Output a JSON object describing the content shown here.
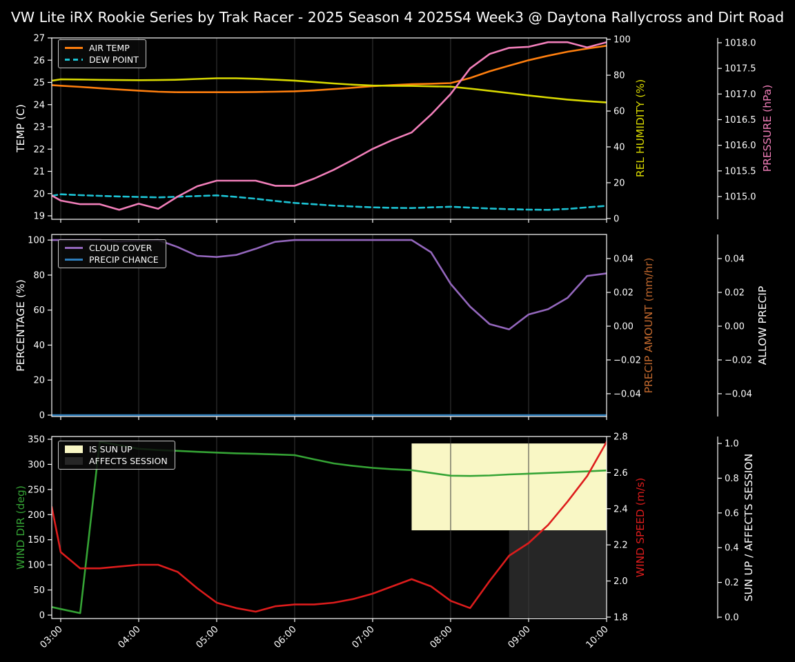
{
  "title": "VW Lite iRX Rookie Series by Trak Racer - 2025 Season 4 2025S4 Week3 @ Daytona Rallycross and Dirt Road",
  "colors": {
    "background": "#000000",
    "text": "#ffffff",
    "grid": "#3a3a3a",
    "spine": "#ffffff",
    "air_temp": "#ff7f0e",
    "dew_point": "#1cc3d4",
    "rel_humidity": "#d9d900",
    "pressure": "#f27fba",
    "cloud_cover": "#9467bd",
    "precip_chance": "#2e7ebc",
    "precip_amount_label": "#c2692e",
    "wind_dir": "#35a435",
    "wind_speed": "#dd1c1c",
    "sun_band": "#f9f7c5",
    "session_band": "#262626"
  },
  "time": {
    "hours": [
      2.885,
      3,
      3.25,
      3.5,
      3.75,
      4,
      4.25,
      4.5,
      4.75,
      5,
      5.25,
      5.5,
      5.75,
      6,
      6.25,
      6.5,
      6.75,
      7,
      7.25,
      7.5,
      7.75,
      8,
      8.25,
      8.5,
      8.75,
      9,
      9.25,
      9.5,
      9.75,
      10
    ],
    "range": [
      2.885,
      10.0
    ],
    "tick_hours": [
      3,
      4,
      5,
      6,
      7,
      8,
      9,
      10
    ],
    "tick_labels": [
      "03:00",
      "04:00",
      "05:00",
      "06:00",
      "07:00",
      "08:00",
      "09:00",
      "10:00"
    ]
  },
  "chart_data": [
    {
      "type": "line",
      "name": "temperature-humidity-pressure",
      "axes": {
        "left": {
          "label": "TEMP (C)",
          "color": "#ffffff",
          "range": [
            18.845,
            27.0
          ],
          "tick_values": [
            19,
            20,
            21,
            22,
            23,
            24,
            25,
            26,
            27
          ],
          "tick_labels": [
            "19",
            "20",
            "21",
            "22",
            "23",
            "24",
            "25",
            "26",
            "27"
          ]
        },
        "right": {
          "label": "REL HUMIDITY (%)",
          "color": "#d9d900",
          "range": [
            -0.4,
            100.8
          ],
          "tick_values": [
            0,
            20,
            40,
            60,
            80,
            100
          ],
          "tick_labels": [
            "0",
            "20",
            "40",
            "60",
            "80",
            "100"
          ]
        },
        "far_right": {
          "label": "PRESSURE (hPa)",
          "color": "#f27fba",
          "range": [
            1014.556,
            1018.094
          ],
          "tick_values": [
            1015.0,
            1015.5,
            1016.0,
            1016.5,
            1017.0,
            1017.5,
            1018.0
          ],
          "tick_labels": [
            "1015.0",
            "1015.5",
            "1016.0",
            "1016.5",
            "1017.0",
            "1017.5",
            "1018.0"
          ]
        }
      },
      "legend": [
        {
          "label": "AIR TEMP",
          "color": "#ff7f0e",
          "style": "line"
        },
        {
          "label": "DEW POINT",
          "color": "#1cc3d4",
          "style": "dashed-line"
        }
      ],
      "series": [
        {
          "name": "AIR TEMP",
          "axis": "left",
          "color": "#ff7f0e",
          "dash": null,
          "y": [
            24.88,
            24.85,
            24.8,
            24.74,
            24.68,
            24.63,
            24.58,
            24.56,
            24.56,
            24.56,
            24.56,
            24.57,
            24.58,
            24.6,
            24.64,
            24.7,
            24.76,
            24.83,
            24.88,
            24.92,
            24.94,
            24.97,
            25.2,
            25.5,
            25.75,
            26.0,
            26.2,
            26.38,
            26.52,
            26.65
          ]
        },
        {
          "name": "DEW POINT",
          "axis": "left",
          "color": "#1cc3d4",
          "dash": "8,5",
          "y": [
            19.9,
            19.97,
            19.93,
            19.9,
            19.87,
            19.85,
            19.83,
            19.86,
            19.89,
            19.92,
            19.85,
            19.77,
            19.67,
            19.58,
            19.52,
            19.46,
            19.42,
            19.38,
            19.36,
            19.35,
            19.38,
            19.41,
            19.37,
            19.33,
            19.3,
            19.28,
            19.27,
            19.31,
            19.38,
            19.45
          ]
        },
        {
          "name": "REL HUMIDITY",
          "axis": "right",
          "color": "#d9d900",
          "dash": null,
          "y": [
            76.9,
            77.7,
            77.6,
            77.4,
            77.3,
            77.2,
            77.3,
            77.5,
            77.9,
            78.3,
            78.3,
            78.0,
            77.5,
            77.0,
            76.2,
            75.4,
            74.7,
            74.2,
            74.1,
            74.0,
            73.8,
            73.6,
            72.5,
            71.3,
            70.0,
            68.7,
            67.5,
            66.4,
            65.5,
            64.8
          ]
        },
        {
          "name": "PRESSURE",
          "axis": "far_right",
          "color": "#f27fba",
          "dash": null,
          "y": [
            1015.02,
            1014.92,
            1014.85,
            1014.85,
            1014.74,
            1014.86,
            1014.76,
            1015.0,
            1015.2,
            1015.31,
            1015.31,
            1015.31,
            1015.21,
            1015.21,
            1015.35,
            1015.52,
            1015.72,
            1015.93,
            1016.1,
            1016.25,
            1016.6,
            1017.0,
            1017.5,
            1017.78,
            1017.9,
            1017.92,
            1018.01,
            1018.01,
            1017.91,
            1018.01
          ]
        }
      ],
      "bands": []
    },
    {
      "type": "line",
      "name": "cloud-precip",
      "axes": {
        "left": {
          "label": "PERCENTAGE (%)",
          "color": "#ffffff",
          "range": [
            -0.8,
            103.2
          ],
          "tick_values": [
            0,
            20,
            40,
            60,
            80,
            100
          ],
          "tick_labels": [
            "0",
            "20",
            "40",
            "60",
            "80",
            "100"
          ]
        },
        "right": {
          "label": "PRECIP AMOUNT (mm/hr)",
          "color": "#c2692e",
          "range": [
            -0.0535,
            0.0543
          ],
          "tick_values": [
            0.04,
            0.02,
            0,
            -0.02,
            -0.04
          ],
          "tick_labels": [
            "0.04",
            "0.02",
            "0.00",
            "−0.02",
            "−0.04"
          ]
        },
        "far_right": {
          "label": "ALLOW PRECIP",
          "color": "#ffffff",
          "range": [
            -0.0535,
            0.0543
          ],
          "tick_values": [
            0.04,
            0.02,
            0,
            -0.02,
            -0.04
          ],
          "tick_labels": [
            "0.04",
            "0.02",
            "0.00",
            "−0.02",
            "−0.04"
          ]
        }
      },
      "legend": [
        {
          "label": "CLOUD COVER",
          "color": "#9467bd",
          "style": "line"
        },
        {
          "label": "PRECIP CHANCE",
          "color": "#2e7ebc",
          "style": "line"
        }
      ],
      "series": [
        {
          "name": "CLOUD COVER",
          "axis": "left",
          "color": "#9467bd",
          "dash": null,
          "y": [
            100,
            100,
            100,
            100,
            99.2,
            99.6,
            100,
            96,
            91,
            90.3,
            91.5,
            95,
            99,
            100,
            100,
            100,
            100,
            100,
            100,
            100,
            93,
            75,
            62,
            52,
            49,
            57.5,
            60.5,
            67,
            79.5,
            81
          ]
        },
        {
          "name": "PRECIP CHANCE",
          "axis": "left",
          "color": "#2e7ebc",
          "dash": null,
          "y": [
            0,
            0,
            0,
            0,
            0,
            0,
            0,
            0,
            0,
            0,
            0,
            0,
            0,
            0,
            0,
            0,
            0,
            0,
            0,
            0,
            0,
            0,
            0,
            0,
            0,
            0,
            0,
            0,
            0,
            0
          ]
        }
      ],
      "bands": []
    },
    {
      "type": "line",
      "name": "wind-sun-session",
      "axes": {
        "left": {
          "label": "WIND DIR (deg)",
          "color": "#35a435",
          "range": [
            -6.9,
            355.5
          ],
          "tick_values": [
            0,
            50,
            100,
            150,
            200,
            250,
            300,
            350
          ],
          "tick_labels": [
            "0",
            "50",
            "100",
            "150",
            "200",
            "250",
            "300",
            "350"
          ]
        },
        "right": {
          "label": "WIND SPEED (m/s)",
          "color": "#dd1c1c",
          "range": [
            1.792,
            2.8
          ],
          "tick_values": [
            1.8,
            2.0,
            2.2,
            2.4,
            2.6,
            2.8
          ],
          "tick_labels": [
            "1.8",
            "2.0",
            "2.2",
            "2.4",
            "2.6",
            "2.8"
          ]
        },
        "far_right": {
          "label": "SUN UP / AFFECTS SESSION",
          "color": "#ffffff",
          "range": [
            -0.008,
            1.04
          ],
          "tick_values": [
            0,
            0.2,
            0.4,
            0.6,
            0.8,
            1.0
          ],
          "tick_labels": [
            "0.0",
            "0.2",
            "0.4",
            "0.6",
            "0.8",
            "1.0"
          ]
        }
      },
      "legend": [
        {
          "label": "IS SUN UP",
          "color": "#f9f7c5",
          "style": "patch"
        },
        {
          "label": "AFFECTS SESSION",
          "color": "#262626",
          "style": "patch"
        }
      ],
      "series": [
        {
          "name": "WIND DIR",
          "axis": "left",
          "color": "#35a435",
          "dash": null,
          "y": [
            16,
            12,
            4,
            345,
            338,
            331,
            328.5,
            327,
            325,
            323.5,
            322,
            321,
            320,
            318.5,
            310,
            302,
            297,
            293,
            290.5,
            288.5,
            283,
            277.5,
            277,
            278,
            280,
            281.5,
            283,
            284.5,
            286,
            288
          ]
        },
        {
          "name": "WIND SPEED",
          "axis": "right",
          "color": "#dd1c1c",
          "dash": null,
          "y": [
            2.41,
            2.16,
            2.07,
            2.07,
            2.08,
            2.09,
            2.09,
            2.05,
            1.96,
            1.88,
            1.85,
            1.83,
            1.86,
            1.87,
            1.87,
            1.88,
            1.9,
            1.93,
            1.97,
            2.01,
            1.97,
            1.89,
            1.85,
            2.0,
            2.14,
            2.21,
            2.31,
            2.44,
            2.58,
            2.77
          ]
        }
      ],
      "bands": [
        {
          "name": "IS SUN UP",
          "color": "#f9f7c5",
          "axis": "far_right",
          "x": [
            7.5,
            10.0
          ],
          "y": [
            0.5,
            1.0
          ]
        },
        {
          "name": "AFFECTS SESSION",
          "color": "#262626",
          "axis": "far_right",
          "x": [
            8.75,
            10.0
          ],
          "y": [
            0.0,
            0.5
          ]
        }
      ]
    }
  ]
}
